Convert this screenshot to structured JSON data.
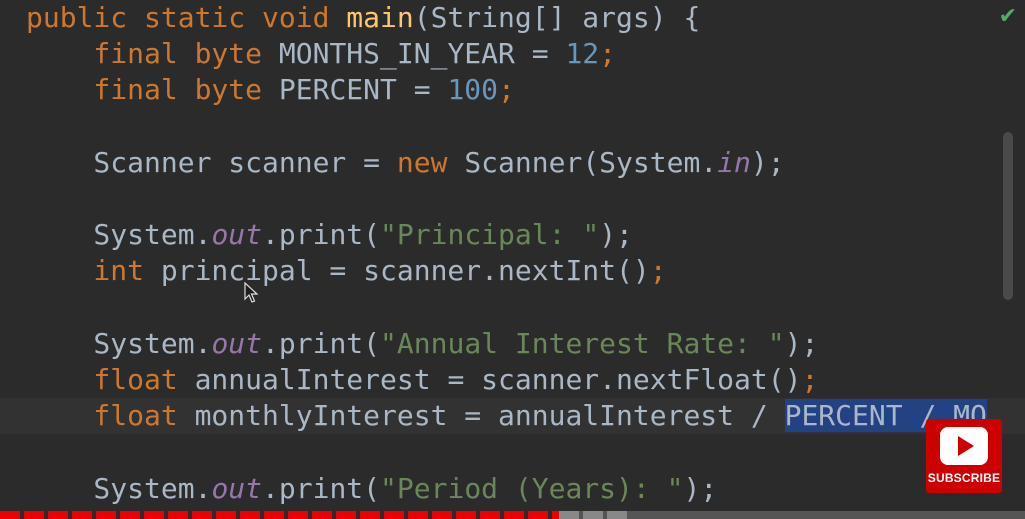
{
  "editor": {
    "lines": [
      [
        {
          "t": "public static void ",
          "c": "kw"
        },
        {
          "t": "main",
          "c": "fn"
        },
        {
          "t": "(String[] args) {",
          "c": "plain"
        }
      ],
      [
        {
          "t": "    final byte ",
          "c": "kw"
        },
        {
          "t": "MONTHS_IN_YEAR = ",
          "c": "plain"
        },
        {
          "t": "12",
          "c": "num"
        },
        {
          "t": ";",
          "c": "kw"
        }
      ],
      [
        {
          "t": "    final byte ",
          "c": "kw"
        },
        {
          "t": "PERCENT = ",
          "c": "plain"
        },
        {
          "t": "100",
          "c": "num"
        },
        {
          "t": ";",
          "c": "kw"
        }
      ],
      [],
      [
        {
          "t": "    Scanner scanner = ",
          "c": "plain"
        },
        {
          "t": "new ",
          "c": "kw"
        },
        {
          "t": "Scanner(System.",
          "c": "plain"
        },
        {
          "t": "in",
          "c": "field"
        },
        {
          "t": ");",
          "c": "plain"
        }
      ],
      [],
      [
        {
          "t": "    System.",
          "c": "plain"
        },
        {
          "t": "out",
          "c": "field"
        },
        {
          "t": ".print(",
          "c": "plain"
        },
        {
          "t": "\"Principal: \"",
          "c": "str"
        },
        {
          "t": ");",
          "c": "plain"
        }
      ],
      [
        {
          "t": "    int ",
          "c": "kw"
        },
        {
          "t": "principal = scanner.nextInt()",
          "c": "plain"
        },
        {
          "t": ";",
          "c": "kw"
        }
      ],
      [],
      [
        {
          "t": "    System.",
          "c": "plain"
        },
        {
          "t": "out",
          "c": "field"
        },
        {
          "t": ".print(",
          "c": "plain"
        },
        {
          "t": "\"Annual Interest Rate: \"",
          "c": "str"
        },
        {
          "t": ");",
          "c": "plain"
        }
      ],
      [
        {
          "t": "    float ",
          "c": "kw"
        },
        {
          "t": "annualInterest = scanner.nextFloat()",
          "c": "plain"
        },
        {
          "t": ";",
          "c": "kw"
        }
      ],
      [
        {
          "t": "    float ",
          "c": "kw"
        },
        {
          "t": "monthlyInterest = annualInterest / ",
          "c": "plain"
        },
        {
          "t": "PERCENT / MO",
          "c": "sel"
        }
      ],
      [],
      [
        {
          "t": "    System.",
          "c": "plain"
        },
        {
          "t": "out",
          "c": "field"
        },
        {
          "t": ".print(",
          "c": "plain"
        },
        {
          "t": "\"Period (Years): \"",
          "c": "str"
        },
        {
          "t": ");",
          "c": "plain"
        }
      ]
    ],
    "current_line_index": 11
  },
  "overlay": {
    "subscribe_label": "SUBSCRIBE"
  },
  "video": {
    "played_fraction": 0.545,
    "buffered_fraction": 0.07
  },
  "colors": {
    "background": "#2b2b2b",
    "keyword": "#cc7832",
    "method": "#ffc66d",
    "number": "#6897bb",
    "string": "#6a8759",
    "field": "#9876aa",
    "text": "#a9b7c6",
    "selection": "#214283",
    "subscribe": "#cc0000",
    "progress": "#ee0000"
  },
  "icons": {
    "status": "checkmark-icon",
    "cursor": "mouse-pointer-icon",
    "subscribe": "play-icon"
  }
}
